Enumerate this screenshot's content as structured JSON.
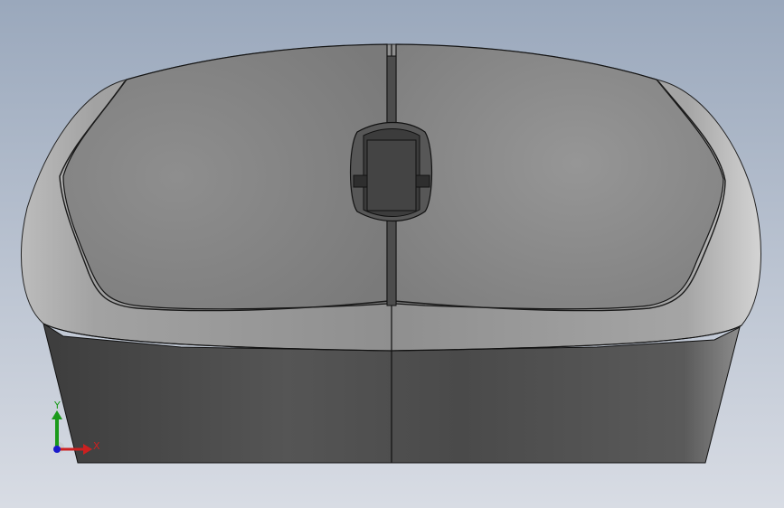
{
  "viewport": {
    "background_top": "#9aa8bc",
    "background_bottom": "#d8dce4"
  },
  "model": {
    "name": "computer mouse",
    "view": "front",
    "body_color": "#8a8a8a",
    "base_color": "#4a4a4a",
    "edge_color": "#111111"
  },
  "triad": {
    "x_label": "X",
    "y_label": "Y",
    "x_color": "#cc2020",
    "y_color": "#1a9a1a",
    "z_color": "#1a1acc"
  }
}
